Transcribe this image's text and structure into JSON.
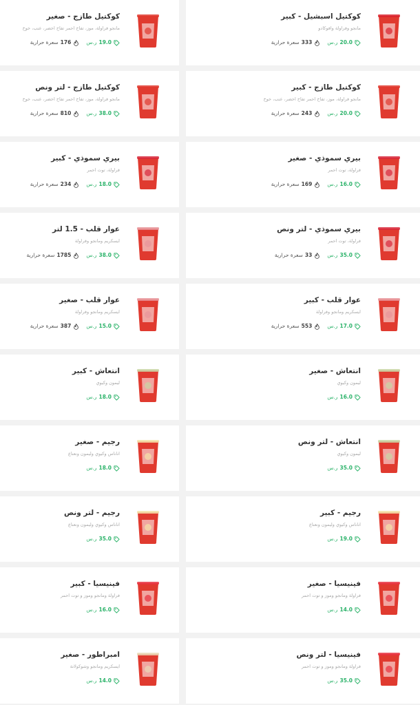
{
  "labels": {
    "currency": "ر.س",
    "calories": "سعرة حرارية"
  },
  "colors": {
    "accent": "#2cb36a",
    "text": "#333333",
    "muted": "#aaaaaa"
  },
  "items": [
    {
      "name": "كوكتيل اسبشيل - كبير",
      "desc": "مانجو وفراولة وافوكادو",
      "price": "20.0",
      "cal": "333",
      "drink": "mango-strawberry",
      "col": "right"
    },
    {
      "name": "كوكتيل طازج - صغير",
      "desc": "مانجو فراولة، موز، تفاح احمر تفاح اخضر، عنب، خوخ",
      "price": "19.0",
      "cal": "176",
      "drink": "red",
      "col": "left"
    },
    {
      "name": "كوكتيل طازج - كبير",
      "desc": "مانجو فراولة، موز، تفاح احمر تفاح اخضر، عنب، خوخ",
      "price": "20.0",
      "cal": "243",
      "drink": "red",
      "col": "right"
    },
    {
      "name": "كوكتيل طازج - لتر ونص",
      "desc": "مانجو فراولة، موز، تفاح احمر تفاح اخضر، عنب، خوخ",
      "price": "38.0",
      "cal": "810",
      "drink": "red",
      "col": "left"
    },
    {
      "name": "بيري سموذي - صغير",
      "desc": "فراولة، توت احمر",
      "price": "16.0",
      "cal": "169",
      "drink": "berry",
      "col": "right"
    },
    {
      "name": "بيري سموذي - كبير",
      "desc": "فراولة، توت احمر",
      "price": "18.0",
      "cal": "234",
      "drink": "berry",
      "col": "left"
    },
    {
      "name": "بيري سموذي - لتر ونص",
      "desc": "فراولة، توت احمر",
      "price": "35.0",
      "cal": "33",
      "drink": "berry",
      "col": "right"
    },
    {
      "name": "عوار قلب - 1.5 لتر",
      "desc": "ايسكريم ومانجو وفراولة",
      "price": "38.0",
      "cal": "1785",
      "drink": "pink",
      "col": "left"
    },
    {
      "name": "عوار قلب - كبير",
      "desc": "ايسكريم ومانجو وفراولة",
      "price": "17.0",
      "cal": "553",
      "drink": "pink",
      "col": "right"
    },
    {
      "name": "عوار قلب - صغير",
      "desc": "ايسكريم ومانجو وفراولة",
      "price": "15.0",
      "cal": "387",
      "drink": "pink",
      "col": "left"
    },
    {
      "name": "انتعاش - صغير",
      "desc": "ليمون وكيوي",
      "price": "16.0",
      "cal": "",
      "drink": "green",
      "col": "right"
    },
    {
      "name": "انتعاش - كبير",
      "desc": "ليمون وكيوي",
      "price": "18.0",
      "cal": "",
      "drink": "green",
      "col": "left"
    },
    {
      "name": "انتعاش - لتر ونص",
      "desc": "ليمون وكيوي",
      "price": "35.0",
      "cal": "",
      "drink": "green",
      "col": "right"
    },
    {
      "name": "رجيم - صغير",
      "desc": "اناناس وكيوي وليمون ونعناع",
      "price": "18.0",
      "cal": "",
      "drink": "yellow",
      "col": "left"
    },
    {
      "name": "رجيم - كبير",
      "desc": "اناناس وكيوي وليمون ونعناع",
      "price": "19.0",
      "cal": "",
      "drink": "yellow",
      "col": "right"
    },
    {
      "name": "رجيم - لتر ونص",
      "desc": "اناناس وكيوي وليمون ونعناع",
      "price": "35.0",
      "cal": "",
      "drink": "yellow",
      "col": "left"
    },
    {
      "name": "فينيسيا - صغير",
      "desc": "فراولة ومانجو وموز و توت احمر",
      "price": "14.0",
      "cal": "",
      "drink": "red-bright",
      "col": "right"
    },
    {
      "name": "فينيسيا - كبير",
      "desc": "فراولة ومانجو وموز و توت احمر",
      "price": "16.0",
      "cal": "",
      "drink": "red-bright",
      "col": "left"
    },
    {
      "name": "فينيسيا - لتر ونص",
      "desc": "فراولة ومانجو وموز و توت احمر",
      "price": "35.0",
      "cal": "",
      "drink": "red-bright",
      "col": "right"
    },
    {
      "name": "امبراطور - صغير",
      "desc": "ايسكريم ومانجو وشوكولاتة",
      "price": "14.0",
      "cal": "",
      "drink": "choco",
      "col": "left"
    }
  ]
}
